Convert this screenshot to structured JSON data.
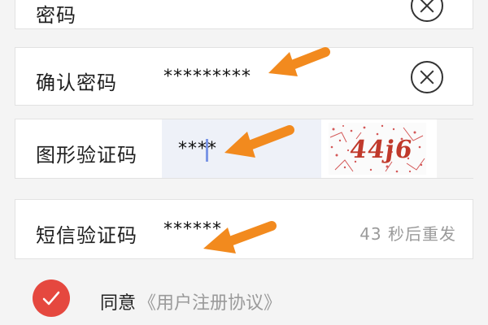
{
  "form": {
    "password": {
      "label": "密码"
    },
    "confirm_password": {
      "label": "确认密码",
      "value": "*********"
    },
    "captcha": {
      "label": "图形验证码",
      "value": "****",
      "image_text": "44j6"
    },
    "sms_code": {
      "label": "短信验证码",
      "value": "******",
      "resend_text": "43 秒后重发"
    }
  },
  "agreement": {
    "checked": true,
    "agree_label": "同意",
    "link_text": "《用户注册协议》"
  },
  "colors": {
    "accent": "#e5483f",
    "arrow": "#f28a1e",
    "muted_text": "#9a9a9a",
    "captcha_text": "#c0392b"
  },
  "icons": [
    "clear-icon",
    "arrow-icon",
    "checkmark-icon"
  ]
}
